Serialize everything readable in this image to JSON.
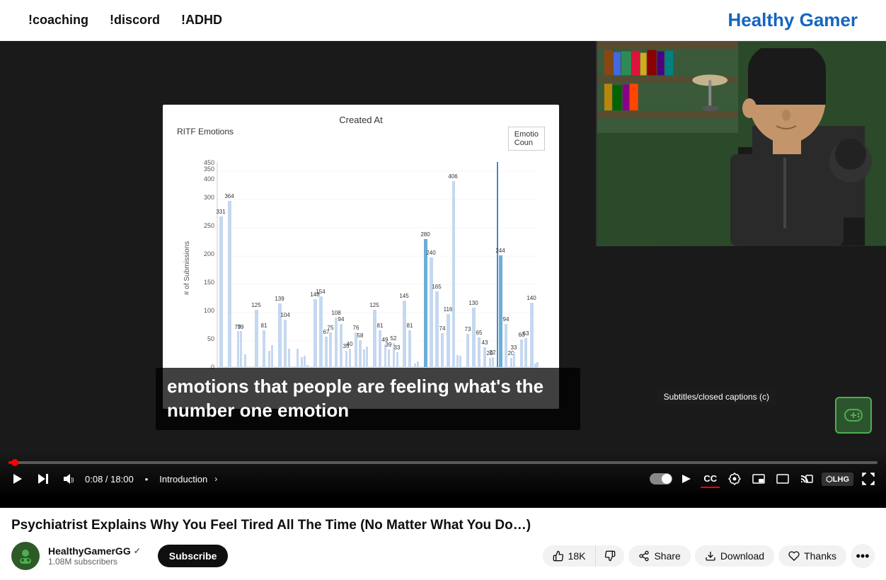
{
  "banner": {
    "cmd1": "!coaching",
    "cmd2": "!discord",
    "cmd3": "!ADHD",
    "title": "Healthy Gamer"
  },
  "video": {
    "title": "Psychiatrist Explains Why You Feel Tired All The Time (No Matter What You Do…)",
    "time_current": "0:08",
    "time_total": "18:00",
    "chapter": "Introduction",
    "captions": "emotions that people are feeling what's the number one emotion",
    "cc_label": "Subtitles/closed captions (c)"
  },
  "chart": {
    "title": "Created At",
    "subtitle": "RITF Emotions",
    "y_axis_label": "# of Submissions",
    "legend_emotion": "Emotio",
    "legend_count": "Coun"
  },
  "channel": {
    "name": "HealthyGamerGG",
    "verified": true,
    "subscribers": "1.08M subscribers",
    "subscribe_label": "Subscribe"
  },
  "actions": {
    "like_count": "18K",
    "share_label": "Share",
    "download_label": "Download",
    "thanks_label": "Thanks"
  },
  "controls": {
    "play_icon": "▶",
    "next_icon": "⏭",
    "volume_icon": "🔊",
    "settings_icon": "⚙",
    "miniplayer_icon": "⧉",
    "theater_icon": "▭",
    "fullscreen_icon": "⛶",
    "cc_icon": "CC"
  }
}
